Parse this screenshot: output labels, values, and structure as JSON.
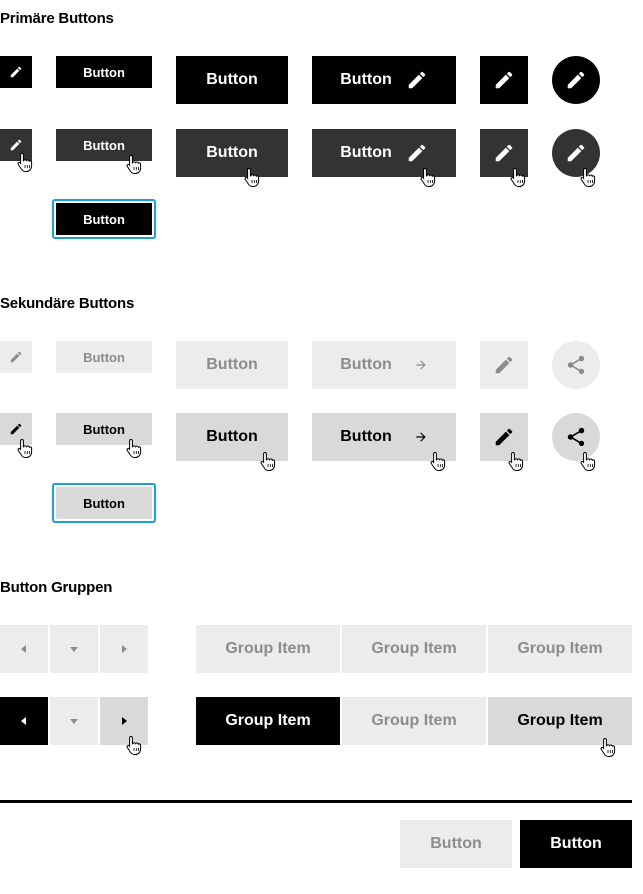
{
  "sections": {
    "primary": "Primäre Buttons",
    "secondary": "Sekundäre Buttons",
    "groups": "Button Gruppen"
  },
  "button_label": "Button",
  "group_item_label": "Group Item",
  "footer": {
    "cancel_label": "Button",
    "confirm_label": "Button"
  },
  "colors": {
    "primary_default": "#000000",
    "primary_hover": "#333333",
    "secondary_default": "#ececec",
    "secondary_hover": "#d9d9d9",
    "focus_ring": "#1aa0d6"
  },
  "icons": [
    "pencil-icon",
    "arrow-right-icon",
    "share-icon",
    "caret-left-icon",
    "caret-down-icon",
    "caret-right-icon",
    "hand-cursor-icon"
  ]
}
